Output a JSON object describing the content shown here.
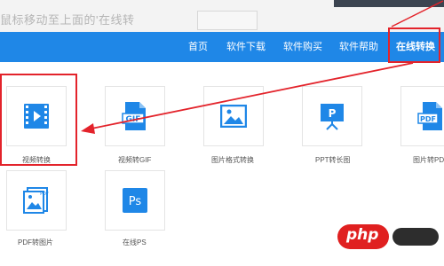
{
  "top": {
    "hint_text": "鼠标移动至上面的'在线转"
  },
  "nav": {
    "items": [
      {
        "label": "首页",
        "active": false
      },
      {
        "label": "软件下载",
        "active": false
      },
      {
        "label": "软件购买",
        "active": false
      },
      {
        "label": "软件帮助",
        "active": false
      },
      {
        "label": "在线转换",
        "active": true
      }
    ],
    "background": "#1f87e7",
    "highlight_color": "#e3232b"
  },
  "tiles": [
    {
      "label": "视频转换",
      "icon": "video-play-icon",
      "highlighted": true
    },
    {
      "label": "视频转GIF",
      "icon": "gif-document-icon",
      "highlighted": false
    },
    {
      "label": "图片格式转换",
      "icon": "image-icon",
      "highlighted": false
    },
    {
      "label": "PPT转长图",
      "icon": "presentation-board-icon",
      "highlighted": false
    },
    {
      "label": "图片转PDF",
      "icon": "pdf-document-icon",
      "highlighted": false
    },
    {
      "label": "PDF转图片",
      "icon": "pdf-to-image-icon",
      "highlighted": false
    },
    {
      "label": "在线PS",
      "icon": "photoshop-icon",
      "highlighted": false
    }
  ],
  "icon_color": "#1f87e7",
  "annotation_color": "#e3232b",
  "watermark": {
    "text": "php"
  }
}
